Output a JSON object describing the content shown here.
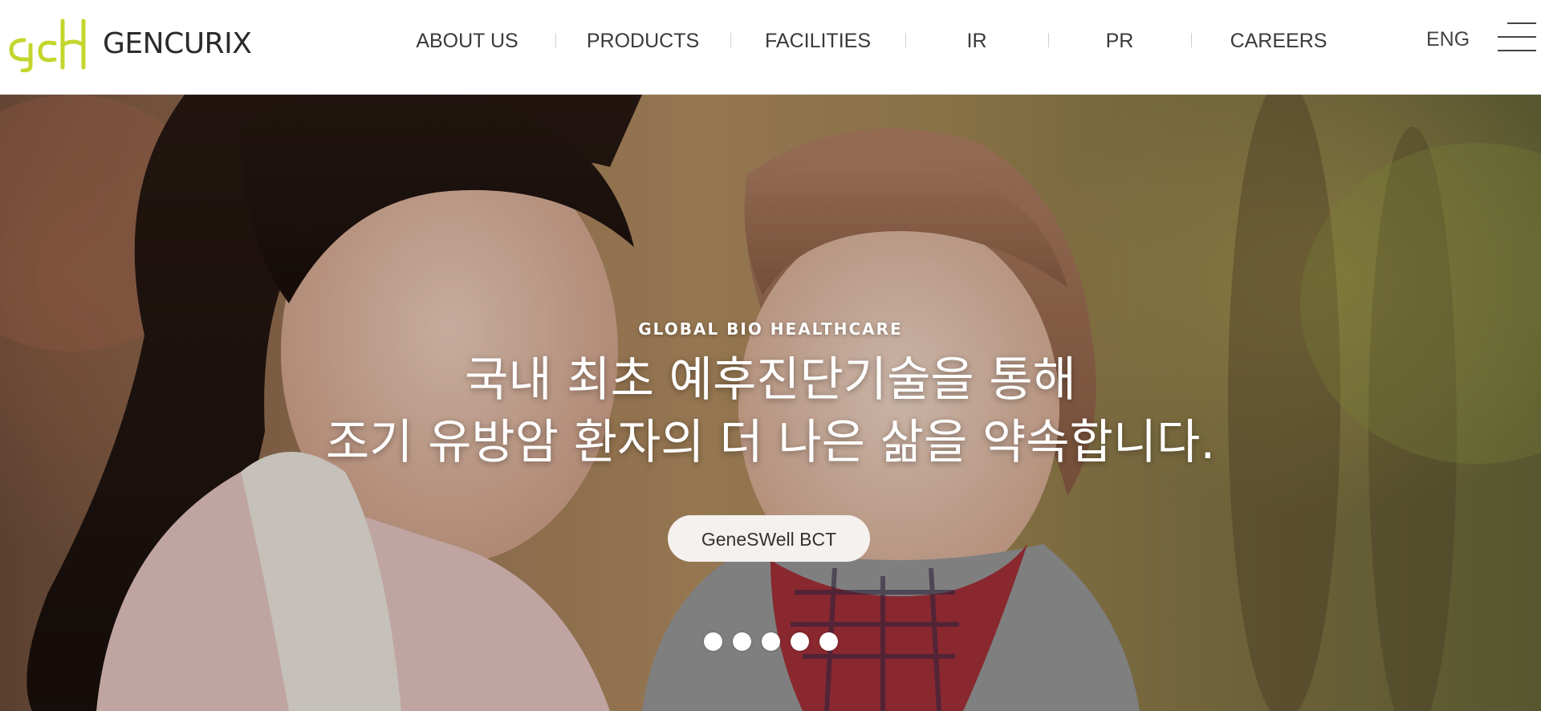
{
  "brand": {
    "name": "GENCURIX",
    "mark_letters": "gcx",
    "mark_color": "#c4d62e",
    "text_color": "#2b2b2b"
  },
  "nav": {
    "items": [
      {
        "label": "ABOUT US"
      },
      {
        "label": "PRODUCTS"
      },
      {
        "label": "FACILITIES"
      },
      {
        "label": "IR"
      },
      {
        "label": "PR"
      },
      {
        "label": "CAREERS"
      }
    ],
    "language": "ENG",
    "menu_icon": "hamburger-icon"
  },
  "hero": {
    "eyebrow": "GLOBAL BIO HEALTHCARE",
    "headline_line1": "국내 최초 예후진단기술을 통해",
    "headline_line2": "조기 유방암 환자의 더 나은 삶을 약속합니다.",
    "cta_label": "GeneSWell BCT",
    "slide_count": 5,
    "active_slide": 1
  }
}
